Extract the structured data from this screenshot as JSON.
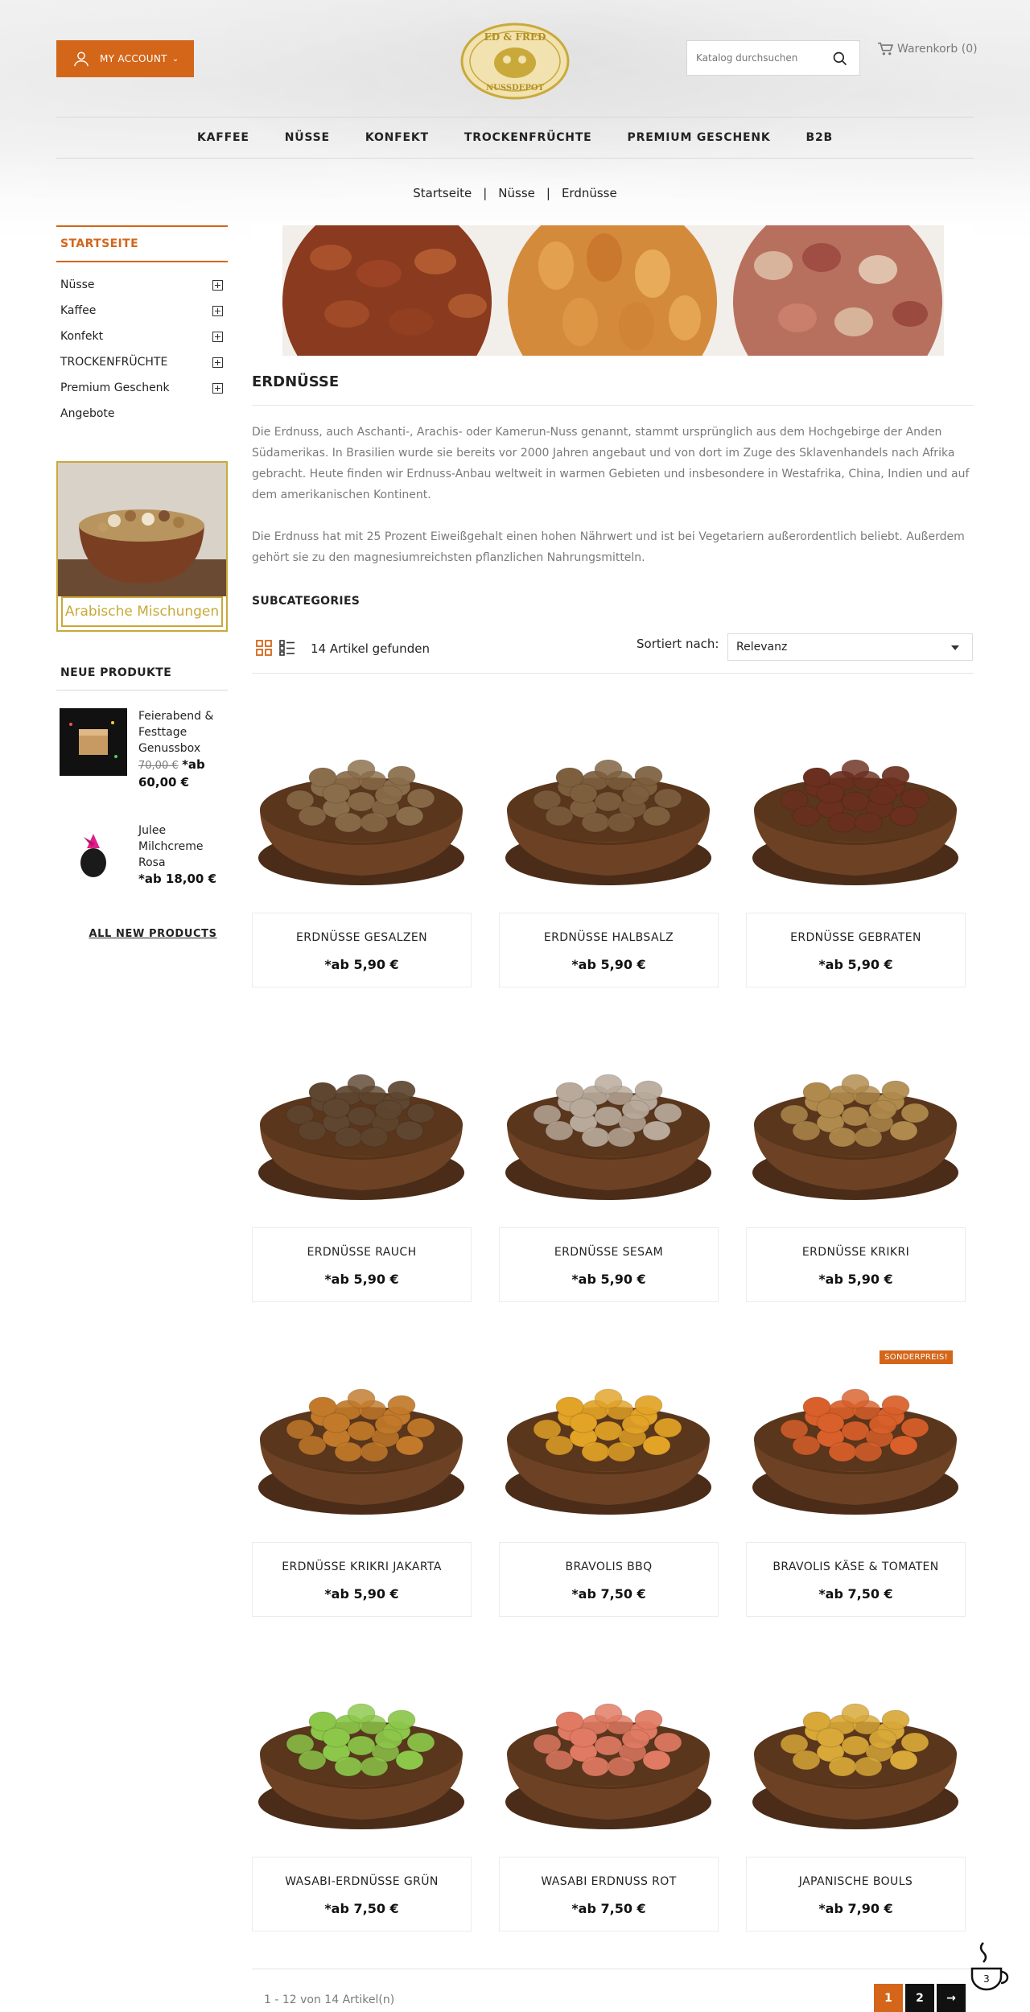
{
  "header": {
    "account_label": "MY ACCOUNT",
    "logo_text": {
      "top": "ED & FRED",
      "bottom": "NUSSDEPOT"
    },
    "search_placeholder": "Katalog durchsuchen",
    "cart_label": "Warenkorb (0)"
  },
  "nav": {
    "items": [
      "KAFFEE",
      "NÜSSE",
      "KONFEKT",
      "TROCKENFRÜCHTE",
      "PREMIUM GESCHENK",
      "B2B"
    ]
  },
  "breadcrumb": [
    "Startseite",
    "Nüsse",
    "Erdnüsse"
  ],
  "sidebar": {
    "heading": "STARTSEITE",
    "categories": [
      {
        "label": "Nüsse",
        "expandable": true
      },
      {
        "label": "Kaffee",
        "expandable": true
      },
      {
        "label": "Konfekt",
        "expandable": true
      },
      {
        "label": "TROCKENFRÜCHTE",
        "expandable": true
      },
      {
        "label": "Premium Geschenk",
        "expandable": true
      },
      {
        "label": "Angebote",
        "expandable": false
      }
    ],
    "promo_label": "Arabische Mischungen",
    "new_products_heading": "NEUE PRODUKTE",
    "new_products": [
      {
        "name": "Feierabend & Festtage Genussbox",
        "old_price": "70,00 €",
        "price": "*ab 60,00 €"
      },
      {
        "name": "Julee Milchcreme Rosa",
        "old_price": "",
        "price": "*ab 18,00 €"
      }
    ],
    "all_new_link": "ALL NEW PRODUCTS"
  },
  "category": {
    "title": "ERDNÜSSE",
    "description": [
      "Die Erdnuss, auch Aschanti-, Arachis- oder Kamerun-Nuss genannt, stammt ursprünglich aus dem Hochgebirge der Anden Südamerikas. In Brasilien wurde sie bereits vor 2000 Jahren angebaut und von dort im Zuge des Sklavenhandels nach Afrika gebracht. Heute finden wir Erdnuss-Anbau weltweit in warmen Gebieten und insbesondere in Westafrika, China, Indien und auf dem amerikanischen Kontinent.",
      "Die Erdnuss hat mit 25 Prozent Eiweißgehalt einen hohen Nährwert und ist bei Vegetariern außerordentlich beliebt. Außerdem gehört sie zu den magnesiumreichsten pflanzlichen Nahrungsmitteln."
    ],
    "subcategories_heading": "SUBCATEGORIES"
  },
  "toolbar": {
    "count": "14 Artikel gefunden",
    "sort_label": "Sortiert nach:",
    "sort_value": "Relevanz"
  },
  "products": [
    {
      "name": "ERDNÜSSE GESALZEN",
      "price": "*ab 5,90 €",
      "badge": "",
      "nut_color": "#8a6d4a"
    },
    {
      "name": "ERDNÜSSE HALBSALZ",
      "price": "*ab 5,90 €",
      "badge": "",
      "nut_color": "#7d5f3e"
    },
    {
      "name": "ERDNÜSSE GEBRATEN",
      "price": "*ab 5,90 €",
      "badge": "",
      "nut_color": "#6b2f1f"
    },
    {
      "name": "ERDNÜSSE RAUCH",
      "price": "*ab 5,90 €",
      "badge": "",
      "nut_color": "#5e4630"
    },
    {
      "name": "ERDNÜSSE SESAM",
      "price": "*ab 5,90 €",
      "badge": "",
      "nut_color": "#b8a99a"
    },
    {
      "name": "ERDNÜSSE KRIKRI",
      "price": "*ab 5,90 €",
      "badge": "",
      "nut_color": "#b08a4c"
    },
    {
      "name": "ERDNÜSSE KRIKRI JAKARTA",
      "price": "*ab 5,90 €",
      "badge": "",
      "nut_color": "#c27a2a"
    },
    {
      "name": "BRAVOLIS BBQ",
      "price": "*ab 7,50 €",
      "badge": "",
      "nut_color": "#e2a326"
    },
    {
      "name": "BRAVOLIS KÄSE & TOMATEN",
      "price": "*ab 7,50 €",
      "badge": "SONDERPREIS!",
      "nut_color": "#d9602a"
    },
    {
      "name": "WASABI-ERDNÜSSE GRÜN",
      "price": "*ab 7,50 €",
      "badge": "",
      "nut_color": "#8cc74a"
    },
    {
      "name": "WASABI ERDNUSS ROT",
      "price": "*ab 7,50 €",
      "badge": "",
      "nut_color": "#e07a62"
    },
    {
      "name": "JAPANISCHE BOULS",
      "price": "*ab 7,90 €",
      "badge": "",
      "nut_color": "#d8a838"
    }
  ],
  "pagination": {
    "info": "1 - 12 von 14 Artikel(n)",
    "pages": [
      "1",
      "2"
    ],
    "next": "→",
    "current": "1"
  },
  "colors": {
    "accent": "#d4661a",
    "gold": "#c9a93a"
  }
}
